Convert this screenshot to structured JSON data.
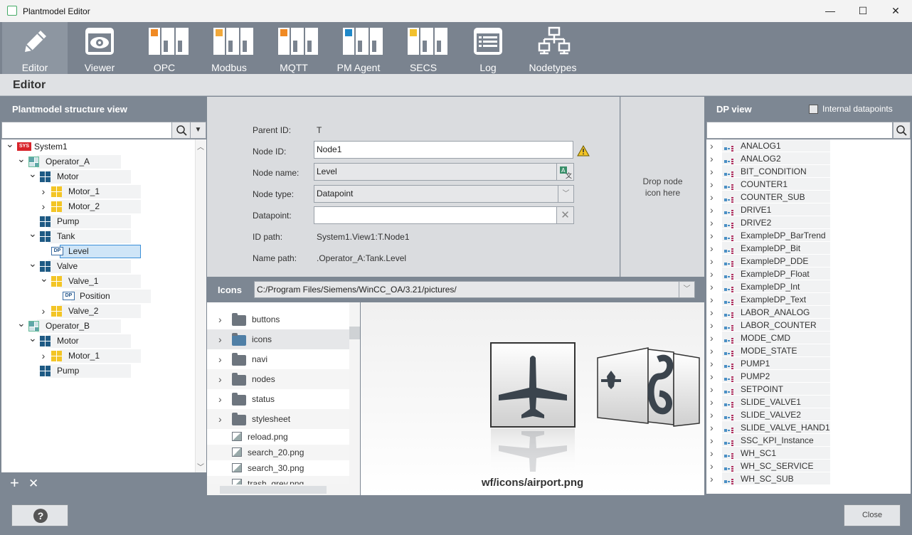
{
  "window": {
    "title": "Plantmodel Editor",
    "minimize": "—",
    "maximize": "☐",
    "close": "✕"
  },
  "toolbar": [
    {
      "label": "Editor",
      "icon": "pencil-icon",
      "active": true
    },
    {
      "label": "Viewer",
      "icon": "eye-icon"
    },
    {
      "label": "OPC",
      "icon": "device-orange-icon"
    },
    {
      "label": "Modbus",
      "icon": "device-orange-icon"
    },
    {
      "label": "MQTT",
      "icon": "device-orange-icon"
    },
    {
      "label": "PM Agent",
      "icon": "device-blue-icon"
    },
    {
      "label": "SECS",
      "icon": "device-yellow-icon"
    },
    {
      "label": "Log",
      "icon": "log-icon"
    },
    {
      "label": "Nodetypes",
      "icon": "network-icon"
    }
  ],
  "editor": {
    "title": "Editor"
  },
  "left": {
    "title": "Plantmodel structure view",
    "search_placeholder": "",
    "tree": [
      {
        "label": "System1",
        "level": 0,
        "icon": "sys",
        "expanded": true
      },
      {
        "label": "Operator_A",
        "level": 1,
        "icon": "op",
        "expanded": true
      },
      {
        "label": "Motor",
        "level": 2,
        "icon": "blue",
        "expanded": true
      },
      {
        "label": "Motor_1",
        "level": 3,
        "icon": "yellow",
        "expanded": false
      },
      {
        "label": "Motor_2",
        "level": 3,
        "icon": "yellow",
        "expanded": false
      },
      {
        "label": "Pump",
        "level": 2,
        "icon": "blue",
        "expanded": null
      },
      {
        "label": "Tank",
        "level": 2,
        "icon": "blue",
        "expanded": true
      },
      {
        "label": "Level",
        "level": 3,
        "icon": "dp",
        "expanded": null,
        "selected": true
      },
      {
        "label": "Valve",
        "level": 2,
        "icon": "blue",
        "expanded": true
      },
      {
        "label": "Valve_1",
        "level": 3,
        "icon": "yellow",
        "expanded": true
      },
      {
        "label": "Position",
        "level": 4,
        "icon": "dp",
        "expanded": null
      },
      {
        "label": "Valve_2",
        "level": 3,
        "icon": "yellow",
        "expanded": false
      },
      {
        "label": "Operator_B",
        "level": 1,
        "icon": "op",
        "expanded": true
      },
      {
        "label": "Motor",
        "level": 2,
        "icon": "blue",
        "expanded": true
      },
      {
        "label": "Motor_1",
        "level": 3,
        "icon": "yellow",
        "expanded": false
      },
      {
        "label": "Pump",
        "level": 2,
        "icon": "blue",
        "expanded": null
      }
    ],
    "add_label": "+",
    "remove_label": "✕"
  },
  "form": {
    "parent_id_label": "Parent ID:",
    "parent_id_value": "T",
    "node_id_label": "Node ID:",
    "node_id_value": "Node1",
    "node_name_label": "Node name:",
    "node_name_value": "Level",
    "node_type_label": "Node type:",
    "node_type_value": "Datapoint",
    "datapoint_label": "Datapoint:",
    "datapoint_value": "",
    "id_path_label": "ID path:",
    "id_path_value": "System1.View1:T.Node1",
    "name_path_label": "Name path:",
    "name_path_value": ".Operator_A:Tank.Level",
    "drop_text_1": "Drop node",
    "drop_text_2": "icon here"
  },
  "icons": {
    "label": "Icons",
    "path": "C:/Program Files/Siemens/WinCC_OA/3.21/pictures/",
    "items": [
      {
        "name": "buttons",
        "type": "folder"
      },
      {
        "name": "icons",
        "type": "folder",
        "selected": true
      },
      {
        "name": "navi",
        "type": "folder"
      },
      {
        "name": "nodes",
        "type": "folder"
      },
      {
        "name": "status",
        "type": "folder"
      },
      {
        "name": "stylesheet",
        "type": "folder"
      },
      {
        "name": "reload.png",
        "type": "file"
      },
      {
        "name": "search_20.png",
        "type": "file"
      },
      {
        "name": "search_30.png",
        "type": "file"
      },
      {
        "name": "trash_grey.png",
        "type": "file"
      }
    ],
    "preview_caption": "wf/icons/airport.png"
  },
  "right": {
    "title": "DP view",
    "internal_label": "Internal datapoints",
    "items": [
      "ANALOG1",
      "ANALOG2",
      "BIT_CONDITION",
      "COUNTER1",
      "COUNTER_SUB",
      "DRIVE1",
      "DRIVE2",
      "ExampleDP_BarTrend",
      "ExampleDP_Bit",
      "ExampleDP_DDE",
      "ExampleDP_Float",
      "ExampleDP_Int",
      "ExampleDP_Text",
      "LABOR_ANALOG",
      "LABOR_COUNTER",
      "MODE_CMD",
      "MODE_STATE",
      "PUMP1",
      "PUMP2",
      "SETPOINT",
      "SLIDE_VALVE1",
      "SLIDE_VALVE2",
      "SLIDE_VALVE_HAND1",
      "SSC_KPI_Instance",
      "WH_SC1",
      "WH_SC_SERVICE",
      "WH_SC_SUB"
    ]
  },
  "footer": {
    "help_label": "?",
    "close_label": "Close"
  },
  "colors": {
    "panel": "#7d8793",
    "toolbar": "#7a838f",
    "form_bg": "#dadcdf",
    "selected": "#cfe5f7"
  }
}
